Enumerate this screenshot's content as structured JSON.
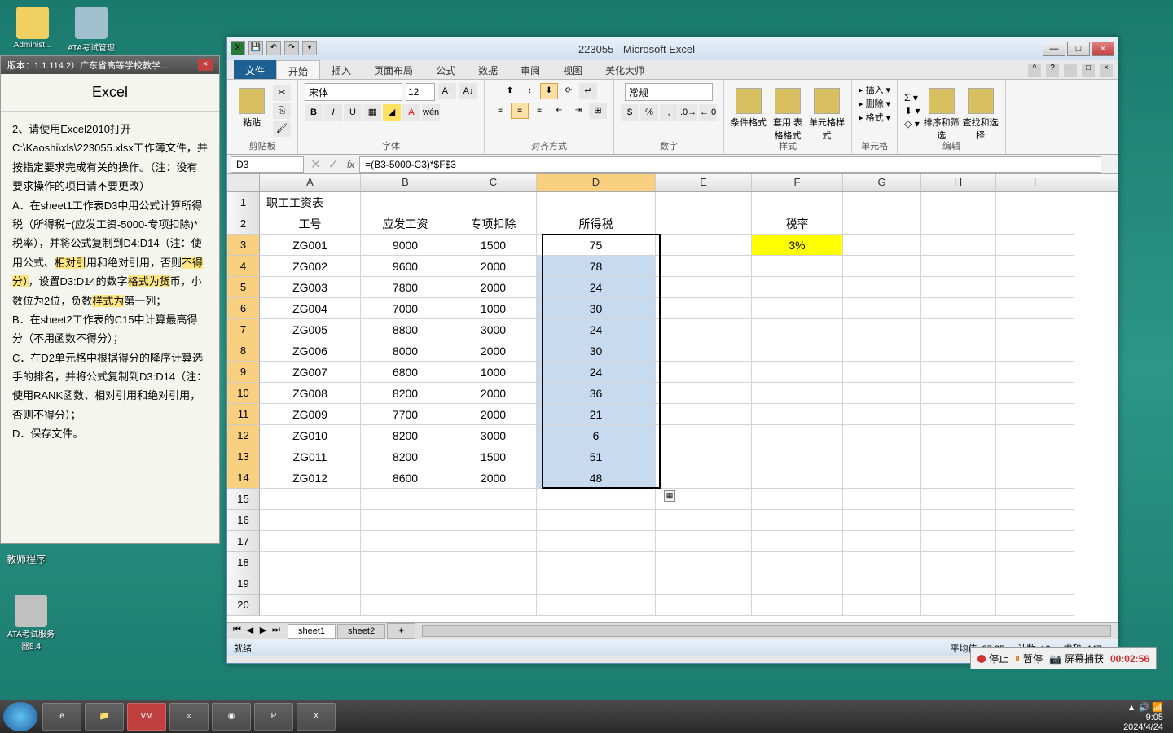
{
  "desktop": {
    "icon1": "Administ...",
    "icon2": "ATA考试管理"
  },
  "leftPanel": {
    "titlebar": "版本：1.1.114.2）广东省高等学校教学...",
    "heading": "Excel",
    "para1": "2、请使用Excel2010打开C:\\Kaoshi\\xls\\223055.xlsx工作簿文件，并按指定要求完成有关的操作。（注：没有要求操作的项目请不要更改）",
    "para2a": "A．在sheet1工作表D3中用公式计算所得税（所得税=(应发工资-5000-专项扣除)*税率），并将公式复制到D4:D14（注：使用公式、",
    "para2hl1": "相对引",
    "para2b": "用和绝对引用，否则",
    "para2hl2": "不得分）",
    "para2c": "，设置D3:D14的数字",
    "para2hl3": "格式为货",
    "para2d": "币，小数位为2位，负数",
    "para2hl4": "样式为",
    "para2e": "第一列；",
    "para3": "B．在sheet2工作表的C15中计算最高得分（不用函数不得分）；",
    "para4": "C．在D2单元格中根据得分的降序计算选手的排名，并将公式复制到D3:D14（注：使用RANK函数、相对引用和绝对引用，否则不得分）；",
    "para5": "D．保存文件。"
  },
  "teacherLabel": "教师程序",
  "ataServer": "ATA考试服务器5.4",
  "excel": {
    "title": "223055 - Microsoft Excel",
    "tabs": {
      "file": "文件",
      "home": "开始",
      "insert": "插入",
      "layout": "页面布局",
      "formula": "公式",
      "data": "数据",
      "review": "审阅",
      "view": "视图",
      "meihua": "美化大师"
    },
    "ribbon": {
      "clipboard": "剪贴板",
      "paste": "粘贴",
      "font": "字体",
      "fontName": "宋体",
      "fontSize": "12",
      "align": "对齐方式",
      "number": "数字",
      "numberFmt": "常规",
      "styles": "样式",
      "condFmt": "条件格式",
      "tblFmt": "套用\n表格格式",
      "cellFmt": "单元格样式",
      "cells": "单元格",
      "insert": "插入",
      "delete": "删除",
      "format": "格式",
      "editing": "编辑",
      "sortFilter": "排序和筛选",
      "findSelect": "查找和选择"
    },
    "nameBox": "D3",
    "formula": "=(B3-5000-C3)*$F$3",
    "cols": [
      "A",
      "B",
      "C",
      "D",
      "E",
      "F",
      "G",
      "H",
      "I"
    ],
    "rowNums": [
      1,
      2,
      3,
      4,
      5,
      6,
      7,
      8,
      9,
      10,
      11,
      12,
      13,
      14,
      15,
      16,
      17,
      18,
      19,
      20
    ],
    "titleCell": "职工工资表",
    "headers": {
      "A": "工号",
      "B": "应发工资",
      "C": "专项扣除",
      "D": "所得税",
      "F": "税率"
    },
    "taxRate": "3%",
    "rows": [
      {
        "a": "ZG001",
        "b": "9000",
        "c": "1500",
        "d": "75"
      },
      {
        "a": "ZG002",
        "b": "9600",
        "c": "2000",
        "d": "78"
      },
      {
        "a": "ZG003",
        "b": "7800",
        "c": "2000",
        "d": "24"
      },
      {
        "a": "ZG004",
        "b": "7000",
        "c": "1000",
        "d": "30"
      },
      {
        "a": "ZG005",
        "b": "8800",
        "c": "3000",
        "d": "24"
      },
      {
        "a": "ZG006",
        "b": "8000",
        "c": "2000",
        "d": "30"
      },
      {
        "a": "ZG007",
        "b": "6800",
        "c": "1000",
        "d": "24"
      },
      {
        "a": "ZG008",
        "b": "8200",
        "c": "2000",
        "d": "36"
      },
      {
        "a": "ZG009",
        "b": "7700",
        "c": "2000",
        "d": "21"
      },
      {
        "a": "ZG010",
        "b": "8200",
        "c": "3000",
        "d": "6"
      },
      {
        "a": "ZG011",
        "b": "8200",
        "c": "1500",
        "d": "51"
      },
      {
        "a": "ZG012",
        "b": "8600",
        "c": "2000",
        "d": "48"
      }
    ],
    "sheets": {
      "s1": "sheet1",
      "s2": "sheet2"
    },
    "status": {
      "ready": "就绪",
      "avg": "平均值: 37.25",
      "count": "计数: 12",
      "sum": "求和: 447"
    }
  },
  "recordBar": {
    "stop": "停止",
    "pause": "暂停",
    "capture": "屏幕捕获",
    "timer": "00:02:56"
  },
  "tray": {
    "time": "9:05",
    "date": "2024/4/24"
  }
}
